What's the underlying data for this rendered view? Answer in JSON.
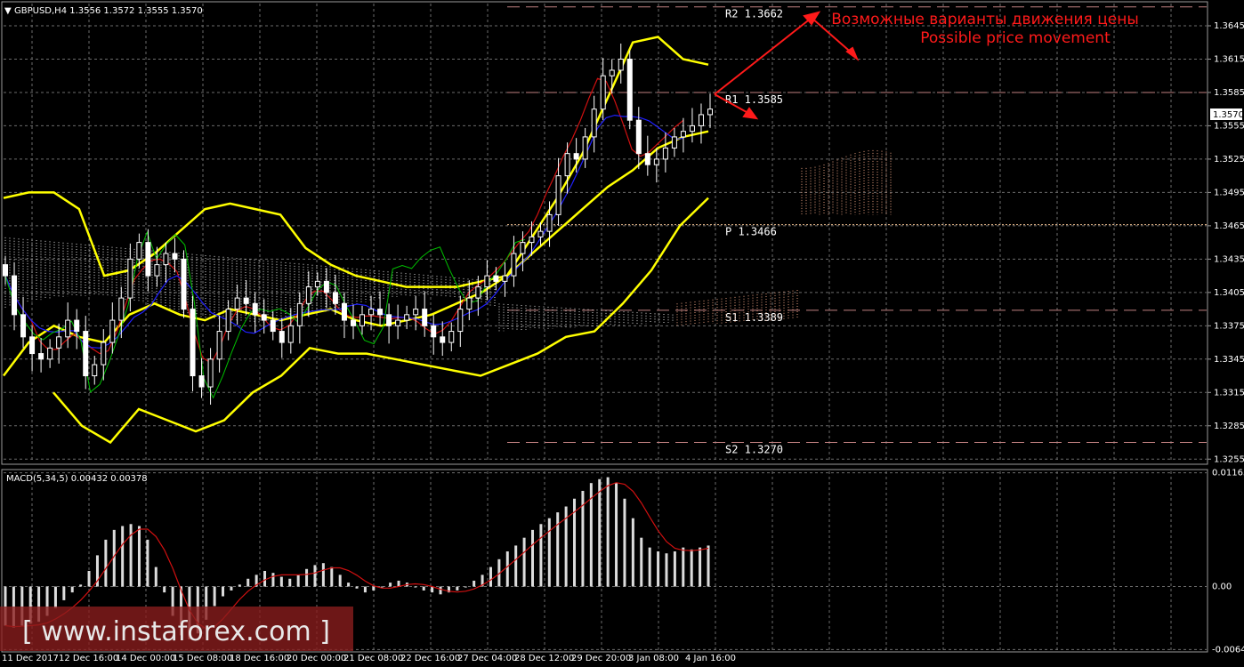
{
  "header": {
    "symbol_line": "GBPUSD,H4  1.3556  1.3572  1.3555  1.3570"
  },
  "macd_header": "MACD(5,34,5)  0.00432  0.00378",
  "annotation": {
    "ru": "Возможные варианты движения цены",
    "en": "Possible price movement"
  },
  "watermark": "[ www.instaforex.com ]",
  "colors": {
    "background": "#000000",
    "grid": "#6b6b6b",
    "bollinger": "#ffff00",
    "candle": "#ffffff",
    "ma_red": "#d01010",
    "ma_blue": "#2020ff",
    "chikou_green": "#00c000",
    "pivot_line": "#f0c090",
    "level_line": "#c08080",
    "annotation": "#ff1a1a",
    "macd_hist": "#dcdcdc",
    "macd_signal": "#d01010"
  },
  "chart_data": [
    {
      "type": "candlestick",
      "symbol": "GBPUSD",
      "timeframe": "H4",
      "ohlc_last": {
        "open": 1.3556,
        "high": 1.3572,
        "low": 1.3555,
        "close": 1.357
      },
      "current_price": "1.3570",
      "ylim": [
        1.3252,
        1.3665
      ],
      "y_ticks": [
        "1.3645",
        "1.3615",
        "1.3585",
        "1.3555",
        "1.3525",
        "1.3495",
        "1.3465",
        "1.3435",
        "1.3405",
        "1.3375",
        "1.3345",
        "1.3315",
        "1.3285",
        "1.3255"
      ],
      "x_ticks": [
        "11 Dec 2017",
        "12 Dec 16:00",
        "14 Dec 00:00",
        "15 Dec 08:00",
        "18 Dec 16:00",
        "20 Dec 00:00",
        "21 Dec 08:00",
        "22 Dec 16:00",
        "27 Dec 04:00",
        "28 Dec 12:00",
        "29 Dec 20:00",
        "3 Jan 08:00",
        "4 Jan 16:00"
      ],
      "levels": [
        {
          "label": "R2 1.3662",
          "value": 1.3662
        },
        {
          "label": "R1 1.3585",
          "value": 1.3585
        },
        {
          "label": "P 1.3466",
          "value": 1.3466
        },
        {
          "label": "S1 1.3389",
          "value": 1.3389
        },
        {
          "label": "S2 1.3270",
          "value": 1.327
        }
      ],
      "close_series": [
        1.342,
        1.3385,
        1.3365,
        1.335,
        1.3345,
        1.3355,
        1.3365,
        1.338,
        1.337,
        1.333,
        1.334,
        1.336,
        1.338,
        1.34,
        1.3435,
        1.345,
        1.342,
        1.343,
        1.344,
        1.3435,
        1.339,
        1.333,
        1.332,
        1.3345,
        1.337,
        1.339,
        1.34,
        1.3395,
        1.3385,
        1.338,
        1.337,
        1.336,
        1.3375,
        1.3395,
        1.341,
        1.3415,
        1.3405,
        1.3395,
        1.338,
        1.3375,
        1.3385,
        1.339,
        1.3385,
        1.3375,
        1.338,
        1.3385,
        1.339,
        1.3375,
        1.3365,
        1.336,
        1.337,
        1.339,
        1.34,
        1.341,
        1.342,
        1.3415,
        1.342,
        1.344,
        1.345,
        1.3455,
        1.346,
        1.3475,
        1.351,
        1.353,
        1.3525,
        1.3545,
        1.357,
        1.36,
        1.3605,
        1.3615,
        1.356,
        1.353,
        1.352,
        1.3525,
        1.3535,
        1.3545,
        1.355,
        1.3555,
        1.3565,
        1.357
      ],
      "bollinger": {
        "upper": [
          1.349,
          1.3495,
          1.3495,
          1.348,
          1.342,
          1.3425,
          1.344,
          1.346,
          1.348,
          1.3485,
          1.348,
          1.3475,
          1.3445,
          1.343,
          1.342,
          1.3415,
          1.341,
          1.341,
          1.341,
          1.3415,
          1.342,
          1.3455,
          1.349,
          1.353,
          1.358,
          1.363,
          1.3635,
          1.3615,
          1.361
        ],
        "middle": [
          1.333,
          1.336,
          1.3375,
          1.3365,
          1.336,
          1.3385,
          1.3395,
          1.3385,
          1.338,
          1.339,
          1.3385,
          1.338,
          1.3385,
          1.339,
          1.338,
          1.3375,
          1.338,
          1.3385,
          1.3395,
          1.3405,
          1.342,
          1.344,
          1.346,
          1.348,
          1.35,
          1.3515,
          1.3535,
          1.3545,
          1.355
        ],
        "lower": [
          1.3315,
          1.3285,
          1.327,
          1.33,
          1.329,
          1.328,
          1.329,
          1.3315,
          1.333,
          1.3355,
          1.335,
          1.335,
          1.3345,
          1.334,
          1.3335,
          1.333,
          1.334,
          1.335,
          1.3365,
          1.337,
          1.3395,
          1.3425,
          1.3465,
          1.349
        ]
      }
    },
    {
      "type": "bar",
      "title": "MACD(5,34,5)",
      "macd": 0.00432,
      "signal": 0.00378,
      "ylim": [
        -0.0066,
        0.0118
      ],
      "y_ticks": [
        "0.01165",
        "0.00",
        "-0.00645"
      ],
      "values": [
        -0.004,
        -0.0042,
        -0.004,
        -0.0038,
        -0.0036,
        -0.003,
        -0.0022,
        -0.0014,
        -0.0006,
        0.0002,
        0.0016,
        0.0032,
        0.0048,
        0.0058,
        0.0062,
        0.0064,
        0.0062,
        0.0048,
        0.002,
        -0.0006,
        -0.003,
        -0.005,
        -0.0054,
        -0.0048,
        -0.0034,
        -0.002,
        -0.001,
        -0.0004,
        0.0002,
        0.0008,
        0.0012,
        0.0016,
        0.0014,
        0.001,
        0.0008,
        0.0012,
        0.0018,
        0.0022,
        0.0024,
        0.002,
        0.0012,
        0.0004,
        -0.0002,
        -0.0006,
        -0.0004,
        0.0,
        0.0004,
        0.0006,
        0.0004,
        0.0,
        -0.0004,
        -0.0006,
        -0.0008,
        -0.0006,
        -0.0004,
        0.0,
        0.0006,
        0.0012,
        0.002,
        0.0028,
        0.0036,
        0.0042,
        0.005,
        0.0058,
        0.0064,
        0.007,
        0.0076,
        0.0082,
        0.009,
        0.0098,
        0.0106,
        0.011,
        0.0112,
        0.0106,
        0.009,
        0.007,
        0.005,
        0.004,
        0.0036,
        0.0034,
        0.0036,
        0.004,
        0.0038,
        0.004,
        0.0042
      ]
    }
  ]
}
